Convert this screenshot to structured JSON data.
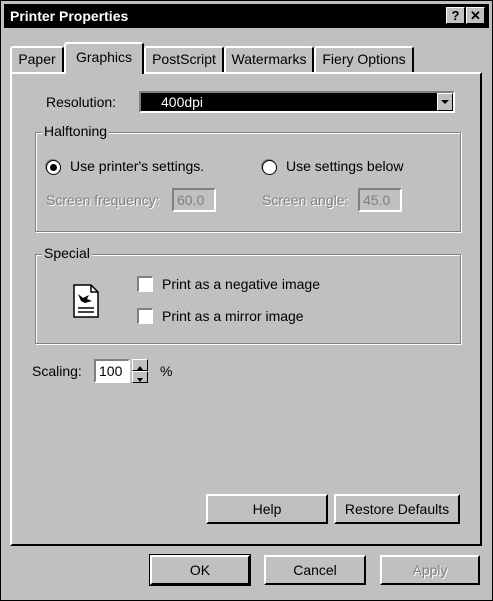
{
  "window": {
    "title": "Printer Properties",
    "help_glyph": "?",
    "close_glyph": "✕"
  },
  "tabs": [
    {
      "label": "Paper",
      "active": false
    },
    {
      "label": "Graphics",
      "active": true
    },
    {
      "label": "PostScript",
      "active": false
    },
    {
      "label": "Watermarks",
      "active": false
    },
    {
      "label": "Fiery Options",
      "active": false
    }
  ],
  "resolution": {
    "label": "Resolution:",
    "value": "400dpi"
  },
  "halftoning": {
    "legend": "Halftoning",
    "use_printer_label": "Use printer's settings.",
    "use_below_label": "Use settings below",
    "selected": "use_printer",
    "screen_frequency_label": "Screen frequency:",
    "screen_frequency_value": "60.0",
    "screen_angle_label": "Screen angle:",
    "screen_angle_value": "45.0"
  },
  "special": {
    "legend": "Special",
    "negative_label": "Print as a negative image",
    "negative_checked": false,
    "mirror_label": "Print as a mirror image",
    "mirror_checked": false,
    "icon": "document-bird-icon"
  },
  "scaling": {
    "label": "Scaling:",
    "value": "100",
    "unit": "%"
  },
  "panel_buttons": {
    "help": "Help",
    "restore": "Restore Defaults"
  },
  "dialog_buttons": {
    "ok": "OK",
    "cancel": "Cancel",
    "apply": "Apply"
  }
}
